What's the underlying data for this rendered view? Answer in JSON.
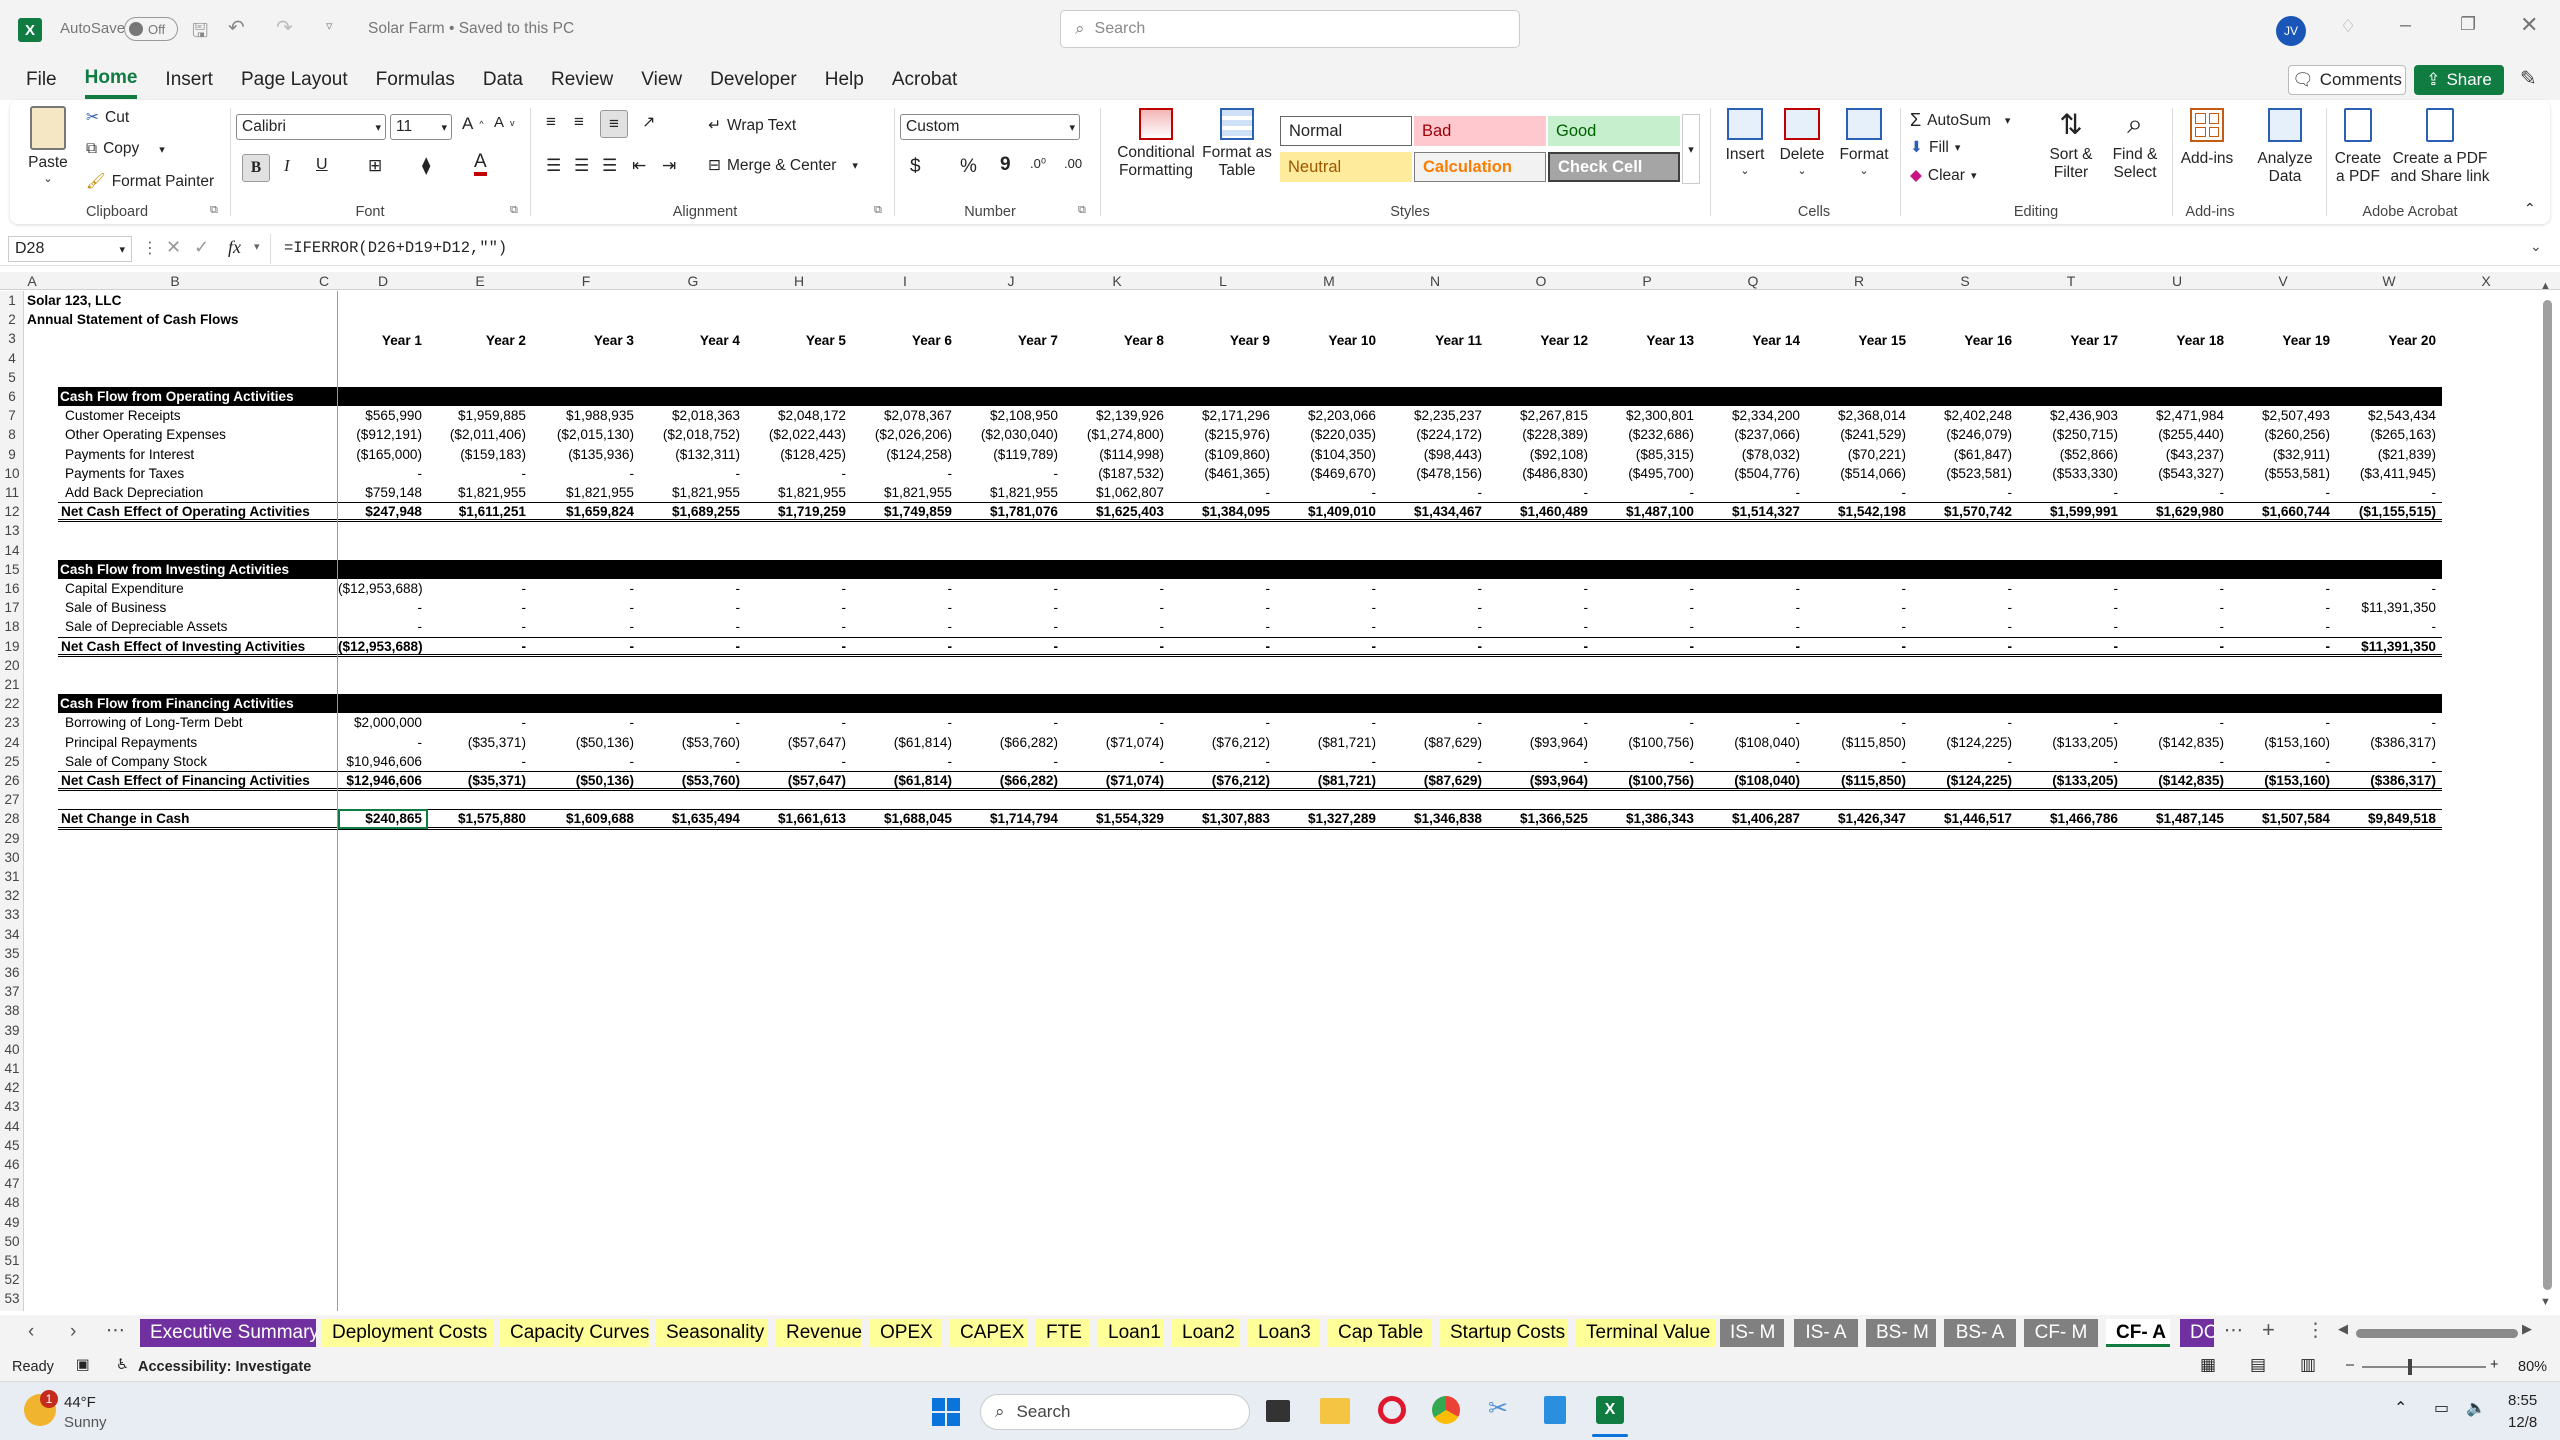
{
  "title_bar": {
    "autosave": "AutoSave",
    "autosave_state": "Off",
    "doc_title": "Solar Farm • Saved to this PC",
    "search_placeholder": "Search",
    "avatar": "JV"
  },
  "menu": [
    "File",
    "Home",
    "Insert",
    "Page Layout",
    "Formulas",
    "Data",
    "Review",
    "View",
    "Developer",
    "Help",
    "Acrobat"
  ],
  "menu_right": {
    "comments": "Comments",
    "share": "Share"
  },
  "ribbon": {
    "clipboard": {
      "paste": "Paste",
      "cut": "Cut",
      "copy": "Copy",
      "format_painter": "Format Painter",
      "label": "Clipboard"
    },
    "font": {
      "name": "Calibri",
      "size": "11",
      "bold": "B",
      "italic": "I",
      "underline": "U",
      "label": "Font"
    },
    "alignment": {
      "wrap": "Wrap Text",
      "merge": "Merge & Center",
      "label": "Alignment"
    },
    "number": {
      "format": "Custom",
      "currency": "$",
      "percent": "%",
      "comma": "9",
      "label": "Number"
    },
    "styles": {
      "conditional": "Conditional Formatting",
      "format_table": "Format as Table",
      "normal": "Normal",
      "bad": "Bad",
      "good": "Good",
      "neutral": "Neutral",
      "calculation": "Calculation",
      "check": "Check Cell",
      "label": "Styles"
    },
    "cells": {
      "insert": "Insert",
      "delete": "Delete",
      "format": "Format",
      "label": "Cells"
    },
    "editing": {
      "autosum": "AutoSum",
      "fill": "Fill",
      "clear": "Clear",
      "sort": "Sort & Filter",
      "find": "Find & Select",
      "label": "Editing"
    },
    "addins": {
      "addins": "Add-ins",
      "analyze": "Analyze Data",
      "label": "Add-ins"
    },
    "acrobat": {
      "create": "Create a PDF",
      "create_share": "Create a PDF and Share link",
      "label": "Adobe Acrobat"
    }
  },
  "formula_bar": {
    "name_box": "D28",
    "fx": "fx",
    "formula": "=IFERROR(D26+D19+D12,\"\")"
  },
  "columns": [
    "A",
    "B",
    "C",
    "D",
    "E",
    "F",
    "G",
    "H",
    "I",
    "J",
    "K",
    "L",
    "M",
    "N",
    "O",
    "P",
    "Q",
    "R",
    "S",
    "T",
    "U",
    "V",
    "W",
    "X"
  ],
  "rows": [
    "1",
    "2",
    "3",
    "4",
    "5",
    "6",
    "7",
    "8",
    "9",
    "10",
    "11",
    "12",
    "13",
    "14",
    "15",
    "16",
    "17",
    "18",
    "19",
    "20",
    "21",
    "22",
    "23",
    "24",
    "25",
    "26",
    "27",
    "28",
    "29",
    "30",
    "31",
    "32",
    "33",
    "34",
    "35",
    "36",
    "37",
    "38",
    "39",
    "40",
    "41",
    "42",
    "43",
    "44",
    "45",
    "46",
    "47",
    "48",
    "49",
    "50",
    "51",
    "52",
    "53"
  ],
  "sheet": {
    "company": "Solar 123, LLC",
    "statement": "Annual Statement of Cash Flows",
    "years": [
      "Year 1",
      "Year 2",
      "Year 3",
      "Year 4",
      "Year 5",
      "Year 6",
      "Year 7",
      "Year 8",
      "Year 9",
      "Year 10",
      "Year 11",
      "Year 12",
      "Year 13",
      "Year 14",
      "Year 15",
      "Year 16",
      "Year 17",
      "Year 18",
      "Year 19",
      "Year 20"
    ],
    "operating": {
      "header": "Cash Flow from Operating Activities",
      "rows": [
        {
          "label": "Customer Receipts",
          "values": [
            "$565,990",
            "$1,959,885",
            "$1,988,935",
            "$2,018,363",
            "$2,048,172",
            "$2,078,367",
            "$2,108,950",
            "$2,139,926",
            "$2,171,296",
            "$2,203,066",
            "$2,235,237",
            "$2,267,815",
            "$2,300,801",
            "$2,334,200",
            "$2,368,014",
            "$2,402,248",
            "$2,436,903",
            "$2,471,984",
            "$2,507,493",
            "$2,543,434"
          ]
        },
        {
          "label": "Other Operating Expenses",
          "values": [
            "($912,191)",
            "($2,011,406)",
            "($2,015,130)",
            "($2,018,752)",
            "($2,022,443)",
            "($2,026,206)",
            "($2,030,040)",
            "($1,274,800)",
            "($215,976)",
            "($220,035)",
            "($224,172)",
            "($228,389)",
            "($232,686)",
            "($237,066)",
            "($241,529)",
            "($246,079)",
            "($250,715)",
            "($255,440)",
            "($260,256)",
            "($265,163)"
          ]
        },
        {
          "label": "Payments for Interest",
          "values": [
            "($165,000)",
            "($159,183)",
            "($135,936)",
            "($132,311)",
            "($128,425)",
            "($124,258)",
            "($119,789)",
            "($114,998)",
            "($109,860)",
            "($104,350)",
            "($98,443)",
            "($92,108)",
            "($85,315)",
            "($78,032)",
            "($70,221)",
            "($61,847)",
            "($52,866)",
            "($43,237)",
            "($32,911)",
            "($21,839)"
          ]
        },
        {
          "label": "Payments for Taxes",
          "values": [
            "-",
            "-",
            "-",
            "-",
            "-",
            "-",
            "-",
            "($187,532)",
            "($461,365)",
            "($469,670)",
            "($478,156)",
            "($486,830)",
            "($495,700)",
            "($504,776)",
            "($514,066)",
            "($523,581)",
            "($533,330)",
            "($543,327)",
            "($553,581)",
            "($3,411,945)"
          ]
        },
        {
          "label": "Add Back Depreciation",
          "values": [
            "$759,148",
            "$1,821,955",
            "$1,821,955",
            "$1,821,955",
            "$1,821,955",
            "$1,821,955",
            "$1,821,955",
            "$1,062,807",
            "-",
            "-",
            "-",
            "-",
            "-",
            "-",
            "-",
            "-",
            "-",
            "-",
            "-",
            "-"
          ]
        }
      ],
      "total": {
        "label": "Net Cash Effect of Operating Activities",
        "values": [
          "$247,948",
          "$1,611,251",
          "$1,659,824",
          "$1,689,255",
          "$1,719,259",
          "$1,749,859",
          "$1,781,076",
          "$1,625,403",
          "$1,384,095",
          "$1,409,010",
          "$1,434,467",
          "$1,460,489",
          "$1,487,100",
          "$1,514,327",
          "$1,542,198",
          "$1,570,742",
          "$1,599,991",
          "$1,629,980",
          "$1,660,744",
          "($1,155,515)"
        ]
      }
    },
    "investing": {
      "header": "Cash Flow from Investing Activities",
      "rows": [
        {
          "label": "Capital Expenditure",
          "values": [
            "($12,953,688)",
            "-",
            "-",
            "-",
            "-",
            "-",
            "-",
            "-",
            "-",
            "-",
            "-",
            "-",
            "-",
            "-",
            "-",
            "-",
            "-",
            "-",
            "-",
            "-"
          ]
        },
        {
          "label": "Sale of Business",
          "values": [
            "-",
            "-",
            "-",
            "-",
            "-",
            "-",
            "-",
            "-",
            "-",
            "-",
            "-",
            "-",
            "-",
            "-",
            "-",
            "-",
            "-",
            "-",
            "-",
            "$11,391,350"
          ]
        },
        {
          "label": "Sale of Depreciable Assets",
          "values": [
            "-",
            "-",
            "-",
            "-",
            "-",
            "-",
            "-",
            "-",
            "-",
            "-",
            "-",
            "-",
            "-",
            "-",
            "-",
            "-",
            "-",
            "-",
            "-",
            "-"
          ]
        }
      ],
      "total": {
        "label": "Net Cash Effect of Investing Activities",
        "values": [
          "($12,953,688)",
          "-",
          "-",
          "-",
          "-",
          "-",
          "-",
          "-",
          "-",
          "-",
          "-",
          "-",
          "-",
          "-",
          "-",
          "-",
          "-",
          "-",
          "-",
          "$11,391,350"
        ]
      }
    },
    "financing": {
      "header": "Cash Flow from Financing Activities",
      "rows": [
        {
          "label": "Borrowing of Long-Term Debt",
          "values": [
            "$2,000,000",
            "-",
            "-",
            "-",
            "-",
            "-",
            "-",
            "-",
            "-",
            "-",
            "-",
            "-",
            "-",
            "-",
            "-",
            "-",
            "-",
            "-",
            "-",
            "-"
          ]
        },
        {
          "label": "Principal Repayments",
          "values": [
            "-",
            "($35,371)",
            "($50,136)",
            "($53,760)",
            "($57,647)",
            "($61,814)",
            "($66,282)",
            "($71,074)",
            "($76,212)",
            "($81,721)",
            "($87,629)",
            "($93,964)",
            "($100,756)",
            "($108,040)",
            "($115,850)",
            "($124,225)",
            "($133,205)",
            "($142,835)",
            "($153,160)",
            "($386,317)"
          ]
        },
        {
          "label": "Sale of Company Stock",
          "values": [
            "$10,946,606",
            "-",
            "-",
            "-",
            "-",
            "-",
            "-",
            "-",
            "-",
            "-",
            "-",
            "-",
            "-",
            "-",
            "-",
            "-",
            "-",
            "-",
            "-",
            "-"
          ]
        }
      ],
      "total": {
        "label": "Net Cash Effect of Financing Activities",
        "values": [
          "$12,946,606",
          "($35,371)",
          "($50,136)",
          "($53,760)",
          "($57,647)",
          "($61,814)",
          "($66,282)",
          "($71,074)",
          "($76,212)",
          "($81,721)",
          "($87,629)",
          "($93,964)",
          "($100,756)",
          "($108,040)",
          "($115,850)",
          "($124,225)",
          "($133,205)",
          "($142,835)",
          "($153,160)",
          "($386,317)"
        ]
      }
    },
    "net_change": {
      "label": "Net Change in Cash",
      "values": [
        "$240,865",
        "$1,575,880",
        "$1,609,688",
        "$1,635,494",
        "$1,661,613",
        "$1,688,045",
        "$1,714,794",
        "$1,554,329",
        "$1,307,883",
        "$1,327,289",
        "$1,346,838",
        "$1,366,525",
        "$1,386,343",
        "$1,406,287",
        "$1,426,347",
        "$1,446,517",
        "$1,466,786",
        "$1,487,145",
        "$1,507,584",
        "$9,849,518"
      ]
    }
  },
  "sheet_tabs": [
    {
      "label": "Executive Summary",
      "bg": "#7030a0",
      "fg": "#ffffff"
    },
    {
      "label": "Deployment Costs",
      "bg": "#ffff99",
      "fg": "#000000"
    },
    {
      "label": "Capacity Curves",
      "bg": "#ffff99",
      "fg": "#000000"
    },
    {
      "label": "Seasonality",
      "bg": "#ffff99",
      "fg": "#000000"
    },
    {
      "label": "Revenue",
      "bg": "#ffff99",
      "fg": "#000000"
    },
    {
      "label": "OPEX",
      "bg": "#ffff99",
      "fg": "#000000"
    },
    {
      "label": "CAPEX",
      "bg": "#ffff99",
      "fg": "#000000"
    },
    {
      "label": "FTE",
      "bg": "#ffff99",
      "fg": "#000000"
    },
    {
      "label": "Loan1",
      "bg": "#ffff99",
      "fg": "#000000"
    },
    {
      "label": "Loan2",
      "bg": "#ffff99",
      "fg": "#000000"
    },
    {
      "label": "Loan3",
      "bg": "#ffff99",
      "fg": "#000000"
    },
    {
      "label": "Cap Table",
      "bg": "#ffff99",
      "fg": "#000000"
    },
    {
      "label": "Startup Costs",
      "bg": "#ffff99",
      "fg": "#000000"
    },
    {
      "label": "Terminal Value",
      "bg": "#ffff99",
      "fg": "#000000"
    },
    {
      "label": "IS- M",
      "bg": "#808080",
      "fg": "#ffffff"
    },
    {
      "label": "IS- A",
      "bg": "#808080",
      "fg": "#ffffff"
    },
    {
      "label": "BS- M",
      "bg": "#808080",
      "fg": "#ffffff"
    },
    {
      "label": "BS- A",
      "bg": "#808080",
      "fg": "#ffffff"
    },
    {
      "label": "CF- M",
      "bg": "#808080",
      "fg": "#ffffff"
    },
    {
      "label": "CF- A",
      "bg": "#ffffff",
      "fg": "#000000"
    },
    {
      "label": "DC",
      "bg": "#7030a0",
      "fg": "#ffffff"
    }
  ],
  "status": {
    "ready": "Ready",
    "accessibility": "Accessibility: Investigate",
    "zoom": "80%"
  },
  "taskbar": {
    "temp": "44°F",
    "weather": "Sunny",
    "search": "Search",
    "time": "8:55",
    "date": "12/8",
    "badge": "1"
  }
}
